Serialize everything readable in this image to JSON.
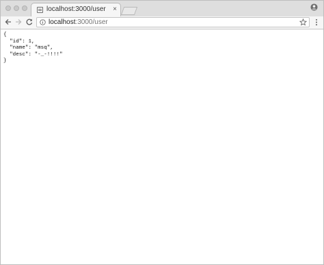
{
  "tab": {
    "title": "localhost:3000/user",
    "close_glyph": "×"
  },
  "omnibox": {
    "host": "localhost",
    "path": ":3000/user"
  },
  "json_text": "{\n  \"id\": 1,\n  \"name\": \"msq\",\n  \"desc\": \"-_-!!!!\"\n}",
  "icons": {
    "tab_favicon": "document-icon",
    "back": "back-arrow-icon",
    "forward": "forward-arrow-icon",
    "reload": "reload-icon",
    "info": "info-icon",
    "star": "star-icon",
    "menu": "kebab-menu-icon",
    "profile": "profile-icon"
  }
}
